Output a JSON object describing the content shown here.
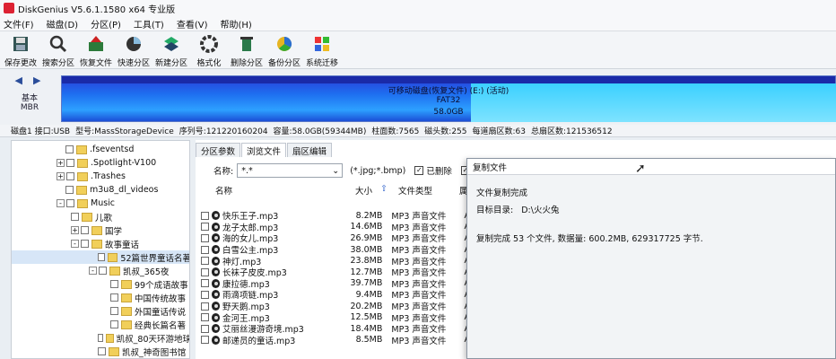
{
  "window": {
    "title": "DiskGenius V5.6.1.1580 x64 专业版"
  },
  "menu": [
    "文件(F)",
    "磁盘(D)",
    "分区(P)",
    "工具(T)",
    "查看(V)",
    "帮助(H)"
  ],
  "toolbar": [
    {
      "label": "保存更改",
      "icon": "save-icon"
    },
    {
      "label": "搜索分区",
      "icon": "search-icon"
    },
    {
      "label": "恢复文件",
      "icon": "recover-icon"
    },
    {
      "label": "快速分区",
      "icon": "quick-partition-icon"
    },
    {
      "label": "新建分区",
      "icon": "new-partition-icon"
    },
    {
      "label": "格式化",
      "icon": "format-icon"
    },
    {
      "label": "删除分区",
      "icon": "delete-icon"
    },
    {
      "label": "备份分区",
      "icon": "backup-icon"
    },
    {
      "label": "系统迁移",
      "icon": "migrate-icon"
    }
  ],
  "diskmap": {
    "nav_line1": "基本",
    "nav_line2": "MBR",
    "partition_label": "可移动磁盘(恢复文件) (E:) (活动)",
    "fs": "FAT32",
    "size": "58.0GB"
  },
  "infobar": [
    "磁盘1 接口:USB",
    "型号:MassStorageDevice",
    "序列号:121220160204",
    "容量:58.0GB(59344MB)",
    "柱面数:7565",
    "磁头数:255",
    "每道扇区数:63",
    "总扇区数:121536512"
  ],
  "tree": [
    {
      "label": ".fseventsd",
      "indent": 60,
      "exp": ""
    },
    {
      "label": ".Spotlight-V100",
      "indent": 50,
      "exp": "+"
    },
    {
      "label": ".Trashes",
      "indent": 50,
      "exp": "+"
    },
    {
      "label": "m3u8_dl_videos",
      "indent": 60,
      "exp": ""
    },
    {
      "label": "Music",
      "indent": 50,
      "exp": "-"
    },
    {
      "label": "儿歌",
      "indent": 66,
      "exp": ""
    },
    {
      "label": "国学",
      "indent": 66,
      "exp": "+"
    },
    {
      "label": "故事童话",
      "indent": 66,
      "exp": "-"
    },
    {
      "label": "52篇世界童话名著",
      "indent": 96,
      "exp": "",
      "sel": true
    },
    {
      "label": "凯叔_365夜",
      "indent": 86,
      "exp": "-"
    },
    {
      "label": "99个成语故事",
      "indent": 110,
      "exp": ""
    },
    {
      "label": "中国传统故事",
      "indent": 110,
      "exp": ""
    },
    {
      "label": "外国童话传说",
      "indent": 110,
      "exp": ""
    },
    {
      "label": "经典长篇名著",
      "indent": 110,
      "exp": ""
    },
    {
      "label": "凯叔_80天环游地球",
      "indent": 96,
      "exp": ""
    },
    {
      "label": "凯叔_神奇图书馆",
      "indent": 96,
      "exp": ""
    }
  ],
  "tabs": [
    "分区参数",
    "浏览文件",
    "扇区编辑"
  ],
  "filter": {
    "name_label": "名称:",
    "name_value": "*.*",
    "hint": "(*.jpg;*.bmp)",
    "deleted_label": "已删除",
    "normal_label": "正常"
  },
  "columns": {
    "name": "名称",
    "size": "大小",
    "type": "文件类型",
    "attr": "属"
  },
  "files": [
    {
      "name": "快乐王子.mp3",
      "size": "8.2MB",
      "type": "MP3 声音文件",
      "attr": "A"
    },
    {
      "name": "龙子太郎.mp3",
      "size": "14.6MB",
      "type": "MP3 声音文件",
      "attr": "A"
    },
    {
      "name": "海的女儿.mp3",
      "size": "26.9MB",
      "type": "MP3 声音文件",
      "attr": "A"
    },
    {
      "name": "白雪公主.mp3",
      "size": "38.0MB",
      "type": "MP3 声音文件",
      "attr": "A"
    },
    {
      "name": "神灯.mp3",
      "size": "23.8MB",
      "type": "MP3 声音文件",
      "attr": "A"
    },
    {
      "name": "长袜子皮皮.mp3",
      "size": "12.7MB",
      "type": "MP3 声音文件",
      "attr": "A"
    },
    {
      "name": "康拉德.mp3",
      "size": "39.7MB",
      "type": "MP3 声音文件",
      "attr": "A"
    },
    {
      "name": "雨滴项链.mp3",
      "size": "9.4MB",
      "type": "MP3 声音文件",
      "attr": "A"
    },
    {
      "name": "野天鹅.mp3",
      "size": "20.2MB",
      "type": "MP3 声音文件",
      "attr": "A"
    },
    {
      "name": "金河王.mp3",
      "size": "12.5MB",
      "type": "MP3 声音文件",
      "attr": "A"
    },
    {
      "name": "艾丽丝漫游奇境.mp3",
      "size": "18.4MB",
      "type": "MP3 声音文件",
      "attr": "A"
    },
    {
      "name": "邮递员的童话.mp3",
      "size": "8.5MB",
      "type": "MP3 声音文件",
      "attr": "A"
    }
  ],
  "dialog": {
    "title": "复制文件",
    "heading": "文件复制完成",
    "target_label": "目标目录:",
    "target_value": "D:\\火火兔",
    "summary": "复制完成 53 个文件, 数据量: 600.2MB, 629317725 字节."
  }
}
